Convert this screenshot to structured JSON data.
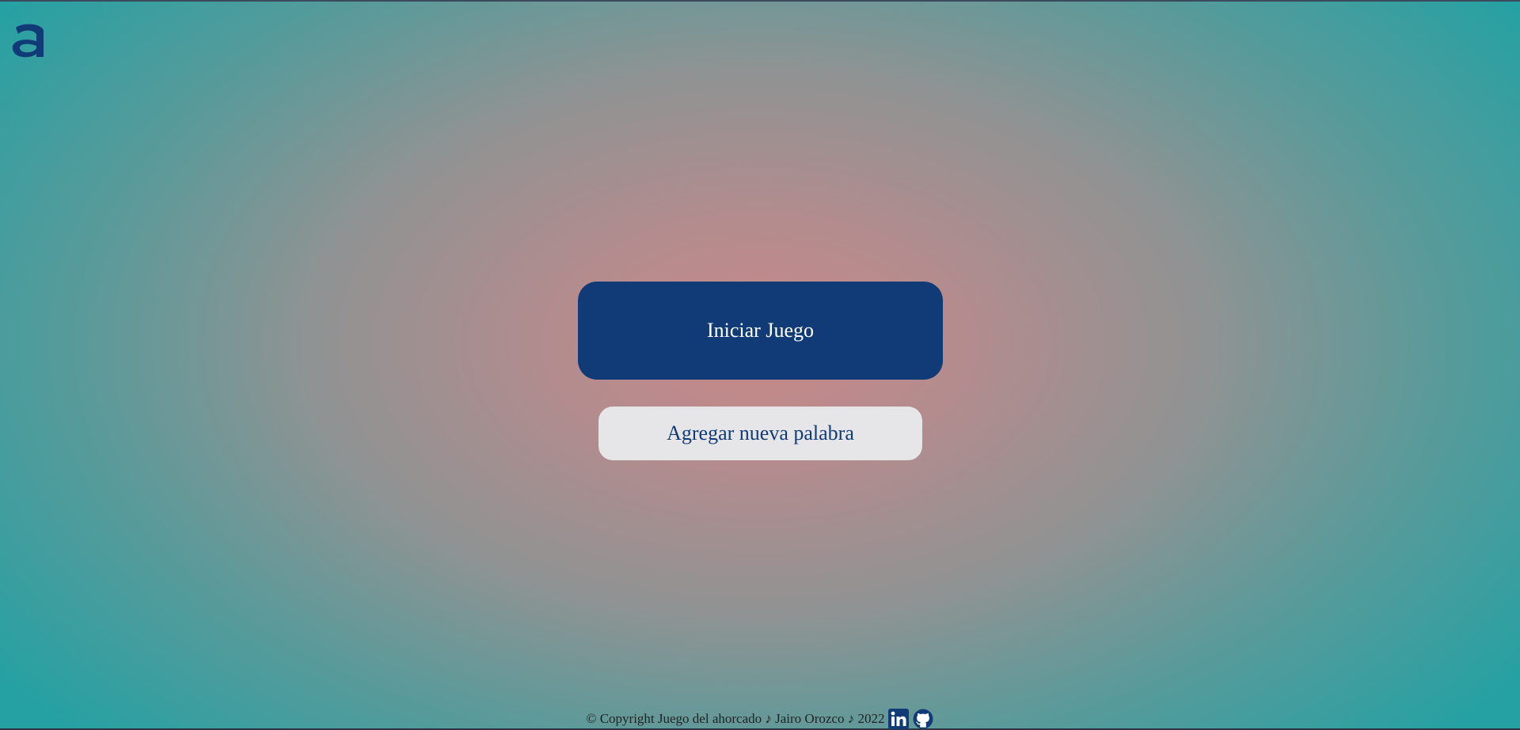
{
  "logo": {
    "letter": "a",
    "color": "#103b76"
  },
  "main": {
    "start_button_label": "Iniciar Juego",
    "add_word_button_label": "Agregar nueva palabra"
  },
  "footer": {
    "copyright_text": "© Copyright Juego del ahorcado ♪ Jairo Orozco ♪ 2022",
    "linkedin_icon": "linkedin-icon",
    "github_icon": "github-icon"
  },
  "colors": {
    "primary": "#103b76",
    "secondary_bg": "#e6e6e8",
    "background_center": "#c98888",
    "background_edge": "#25a1a3"
  }
}
